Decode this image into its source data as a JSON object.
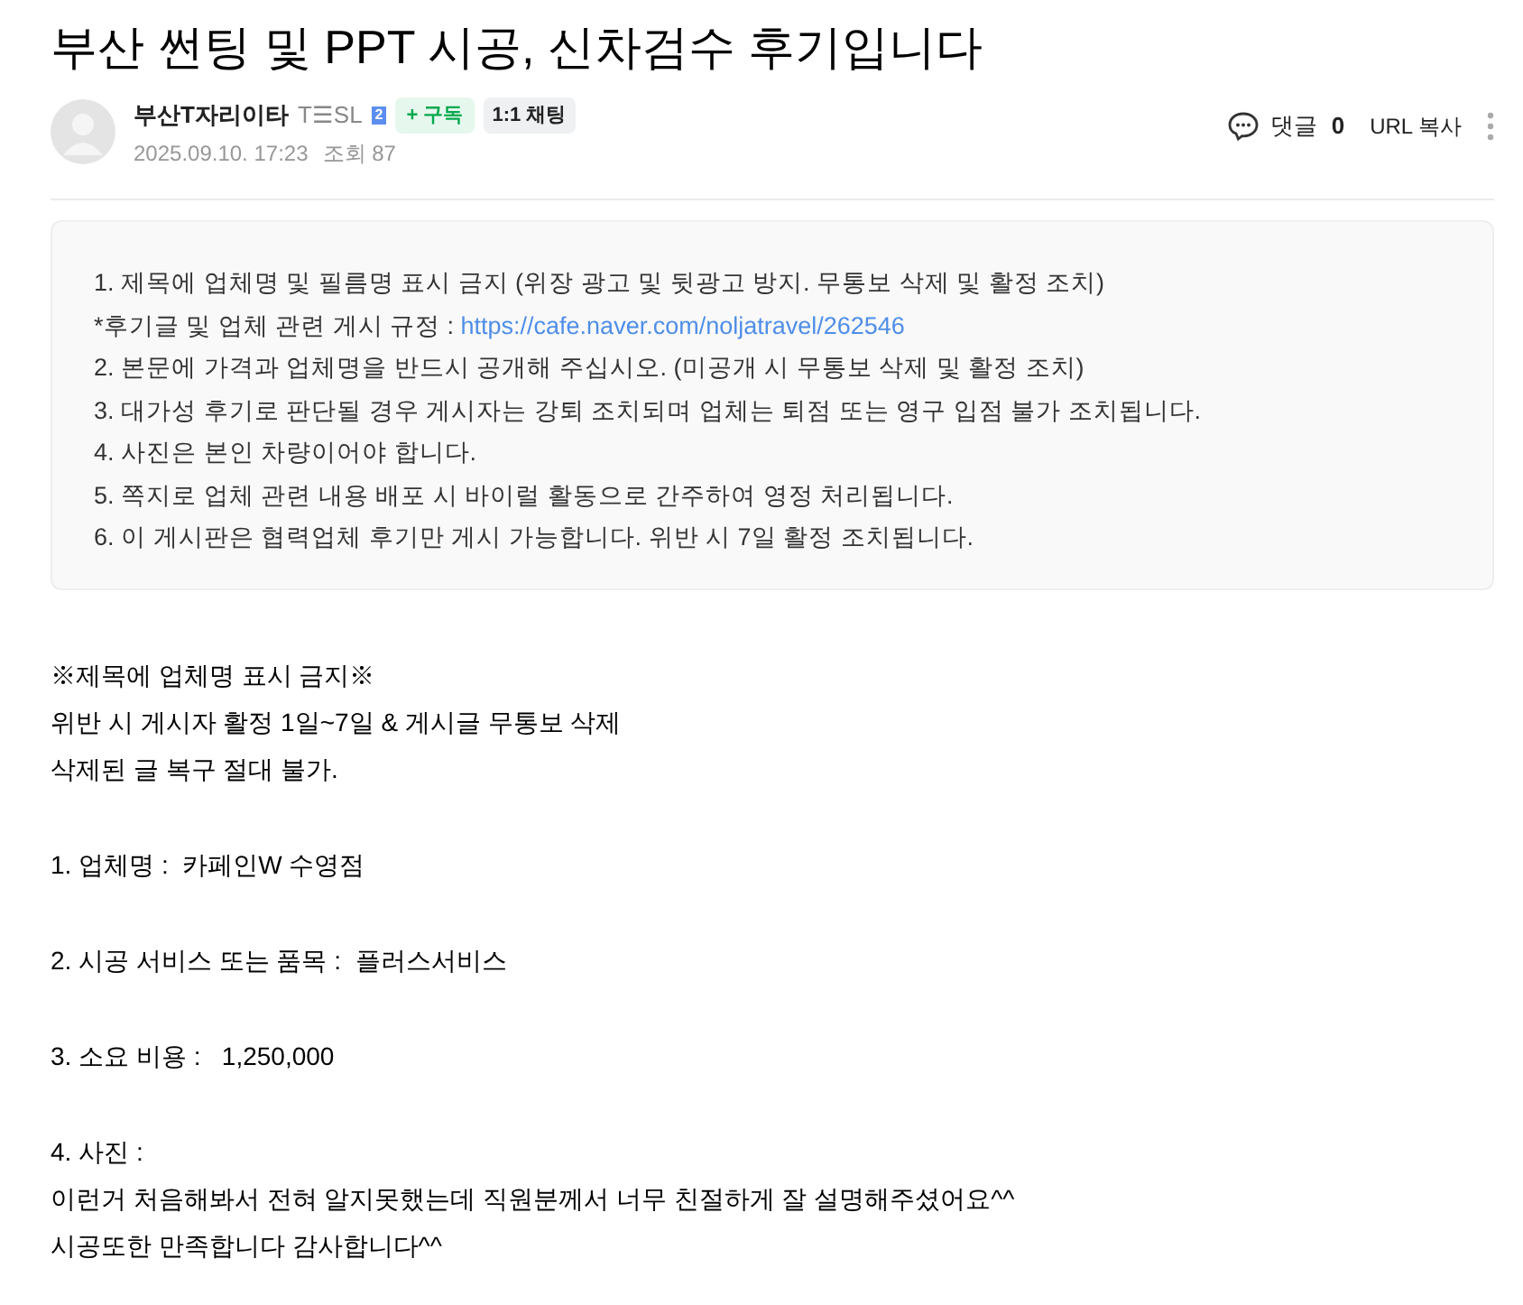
{
  "title": "부산 썬팅 및 PPT 시공, 신차검수 후기입니다",
  "author": {
    "name": "부산T자리이타",
    "nickname_tag": "T☰SL",
    "level_badge": "2",
    "subscribe": "+ 구독",
    "chat": "1:1 채팅",
    "date": "2025.09.10. 17:23",
    "views": "조회 87"
  },
  "actions": {
    "comments_label": "댓글",
    "comments_count": "0",
    "copy_url": "URL 복사"
  },
  "notice": [
    {
      "kind": "text",
      "text": "1. 제목에 업체명 및 필름명 표시 금지 (위장 광고 및 뒷광고 방지. 무통보 삭제 및 활정 조치)"
    },
    {
      "kind": "link",
      "text": "*후기글 및 업체 관련 게시 규정 : ",
      "link": "https://cafe.naver.com/noljatravel/262546"
    },
    {
      "kind": "text",
      "text": "2. 본문에 가격과 업체명을 반드시 공개해 주십시오. (미공개 시 무통보 삭제 및 활정 조치)"
    },
    {
      "kind": "text",
      "text": "3. 대가성 후기로 판단될 경우 게시자는 강퇴 조치되며 업체는 퇴점 또는 영구 입점 불가 조치됩니다."
    },
    {
      "kind": "text",
      "text": "4. 사진은 본인 차량이어야 합니다."
    },
    {
      "kind": "text",
      "text": "5. 쪽지로 업체 관련 내용 배포 시 바이럴 활동으로 간주하여 영정 처리됩니다."
    },
    {
      "kind": "text",
      "text": "6. 이 게시판은 협력업체 후기만 게시 가능합니다. 위반 시 7일 활정 조치됩니다."
    }
  ],
  "body": [
    [
      "※제목에 업체명 표시 금지※",
      "위반 시 게시자 활정 1일~7일 & 게시글 무통보 삭제",
      "삭제된 글 복구 절대 불가."
    ],
    [
      "1. 업체명 :  카페인W 수영점"
    ],
    [
      "2. 시공 서비스 또는 품목 :  플러스서비스"
    ],
    [
      "3. 소요 비용 :   1,250,000"
    ],
    [
      "4. 사진 :",
      "이런거 처음해봐서 전혀 알지못했는데 직원분께서 너무 친절하게 잘 설명해주셨어요^^",
      "시공또한 만족합니다 감사합니다^^"
    ]
  ]
}
